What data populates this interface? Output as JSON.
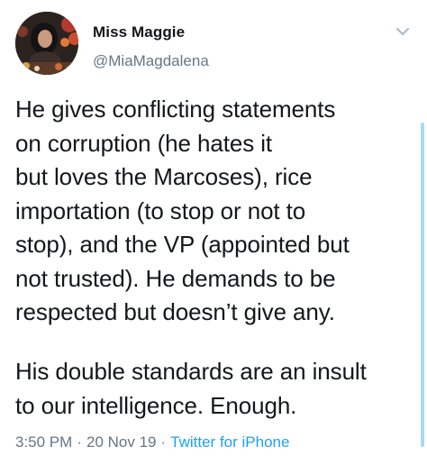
{
  "tweet": {
    "display_name": "Miss Maggie",
    "handle": "@MiaMagdalena",
    "text_para1": "He gives conflicting statements\non corruption (he hates it\nbut loves the Marcoses), rice\nimportation (to stop or not to\nstop), and the VP (appointed but\nnot trusted). He demands to be\nrespected but doesn’t give any.",
    "text_para2": "His double standards are an insult\nto our intelligence. Enough.",
    "time": "3:50 PM",
    "separator": "·",
    "date": "20 Nov 19",
    "source": "Twitter for iPhone"
  },
  "colors": {
    "text": "#14171a",
    "muted": "#657786",
    "link": "#1da1f2",
    "scrollbar": "#a9d8f9"
  },
  "icons": {
    "menu": "chevron-down-icon",
    "avatar": "profile-photo"
  }
}
